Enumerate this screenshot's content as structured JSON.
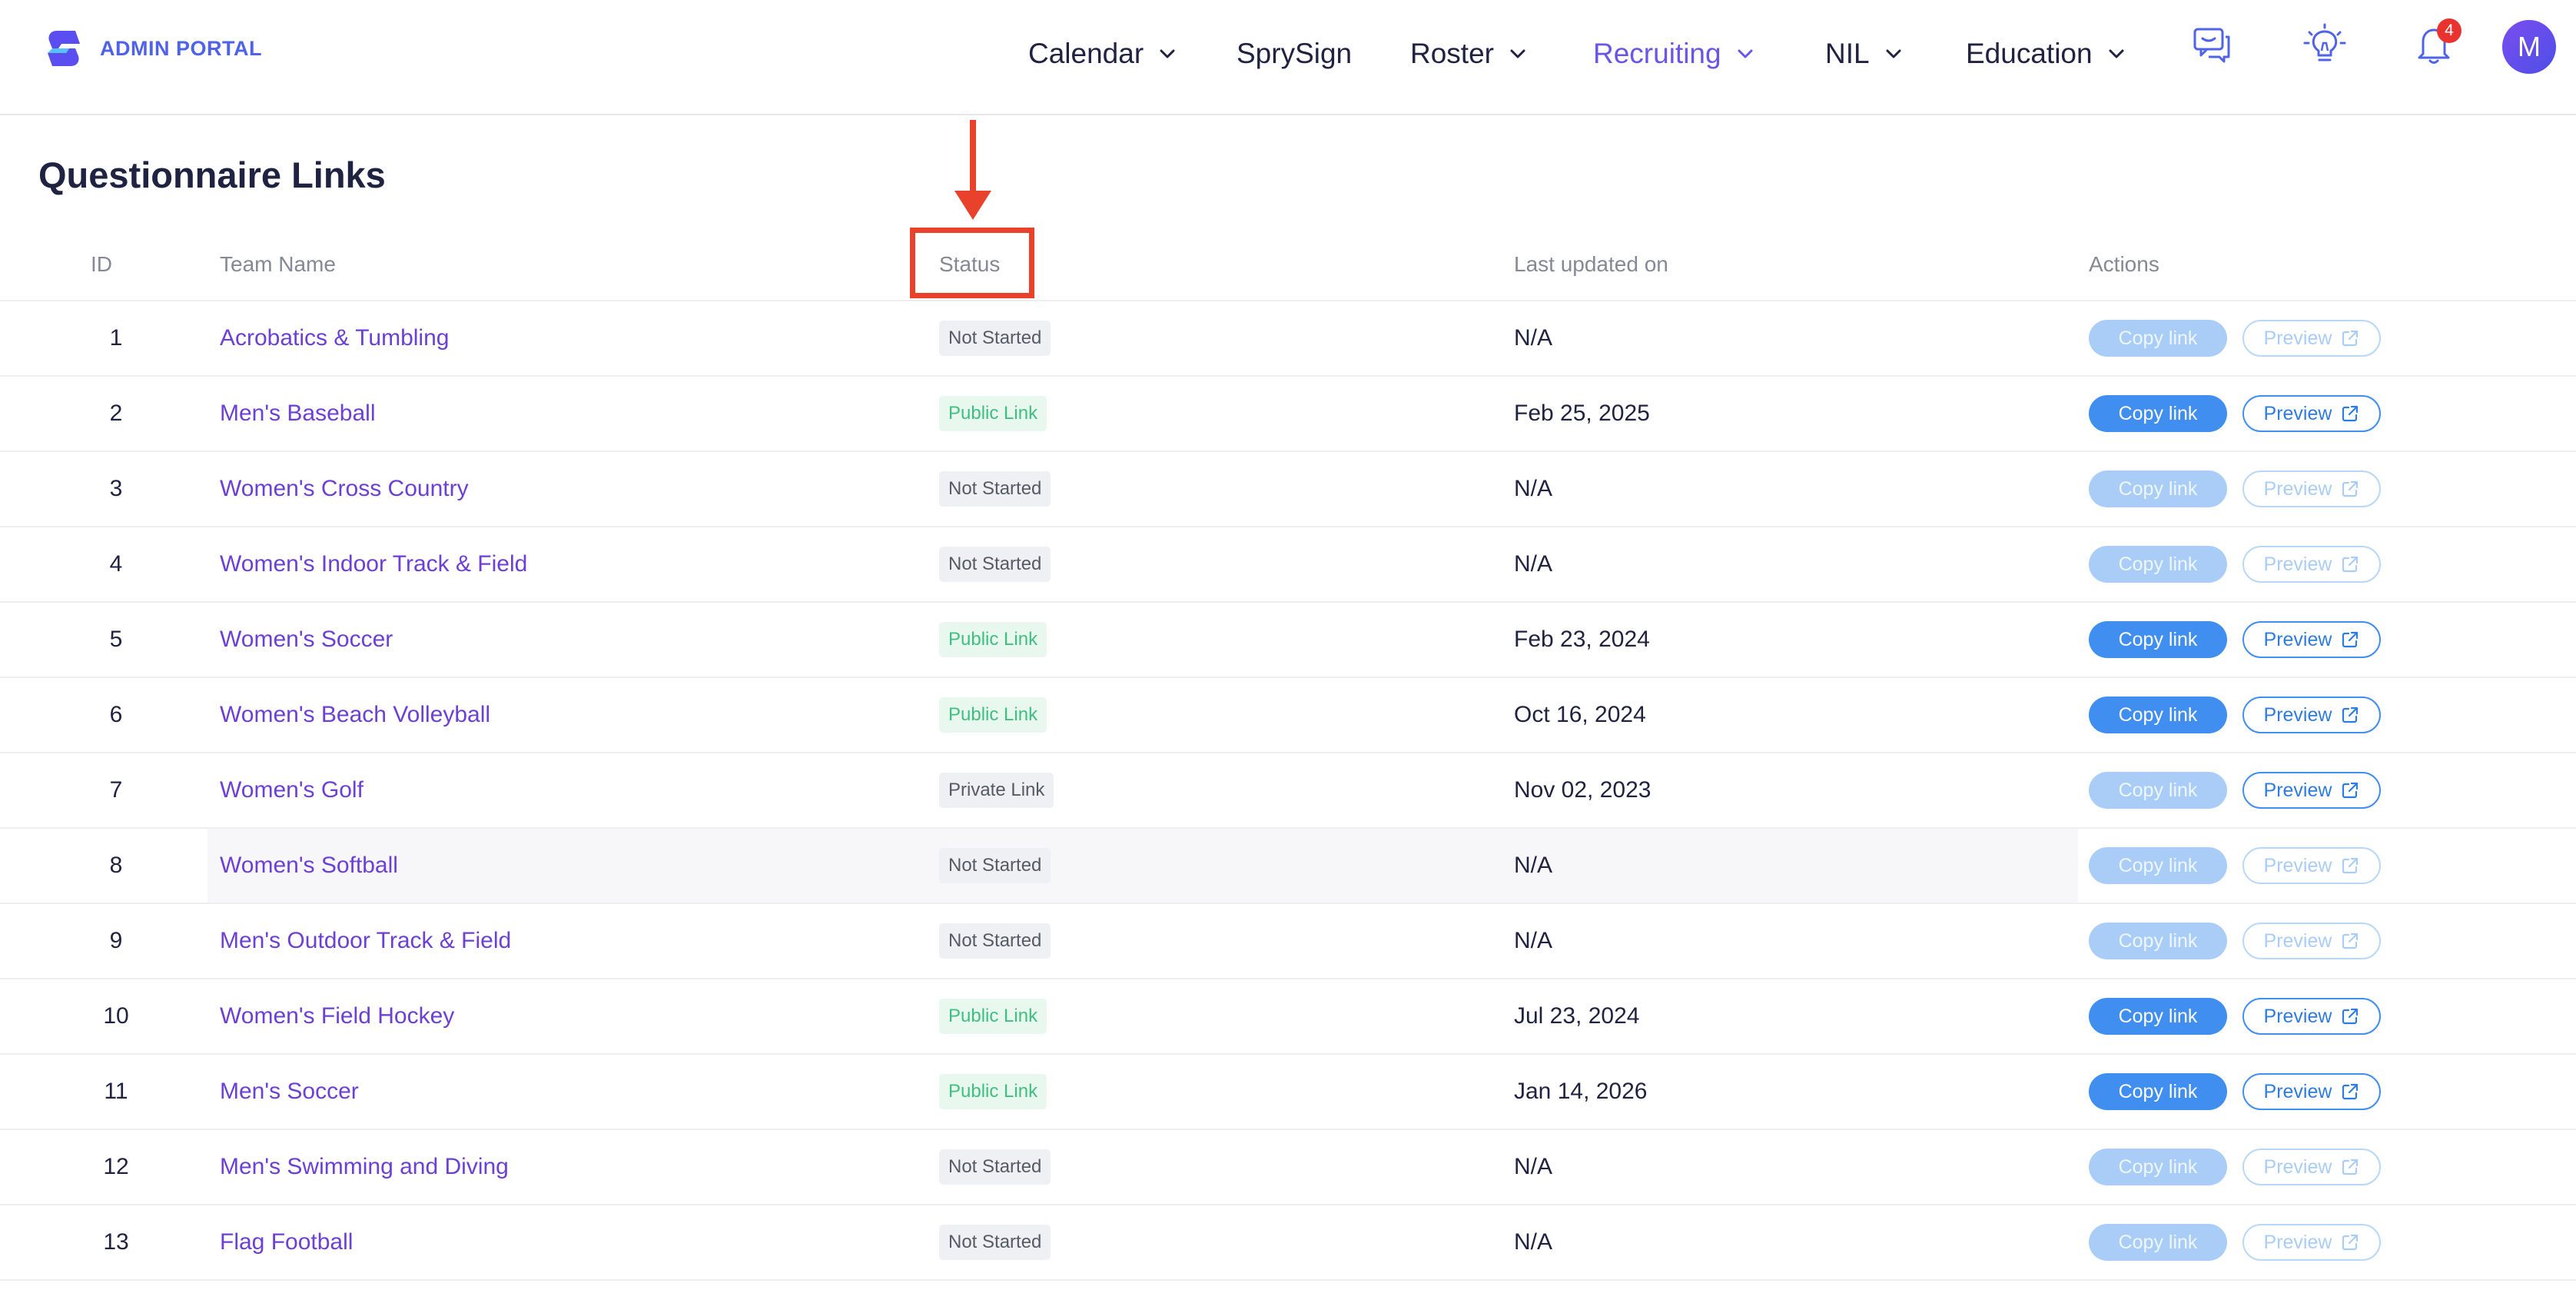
{
  "brand": {
    "name": "ADMIN PORTAL"
  },
  "nav": {
    "calendar": "Calendar",
    "sprysign": "SprySign",
    "roster": "Roster",
    "recruiting": "Recruiting",
    "nil": "NIL",
    "education": "Education"
  },
  "notifications": {
    "count": "4"
  },
  "user": {
    "avatar_initial": "M"
  },
  "page": {
    "title": "Questionnaire Links"
  },
  "table": {
    "headers": {
      "id": "ID",
      "team_name": "Team Name",
      "status": "Status",
      "last_updated": "Last updated on",
      "actions": "Actions"
    },
    "action_labels": {
      "copy": "Copy link",
      "preview": "Preview"
    },
    "rows": [
      {
        "id": "1",
        "team": "Acrobatics & Tumbling",
        "status": "Not Started",
        "updated": "N/A"
      },
      {
        "id": "2",
        "team": "Men's Baseball",
        "status": "Public Link",
        "updated": "Feb 25, 2025"
      },
      {
        "id": "3",
        "team": "Women's Cross Country",
        "status": "Not Started",
        "updated": "N/A"
      },
      {
        "id": "4",
        "team": "Women's Indoor Track & Field",
        "status": "Not Started",
        "updated": "N/A"
      },
      {
        "id": "5",
        "team": "Women's Soccer",
        "status": "Public Link",
        "updated": "Feb 23, 2024"
      },
      {
        "id": "6",
        "team": "Women's Beach Volleyball",
        "status": "Public Link",
        "updated": "Oct 16, 2024"
      },
      {
        "id": "7",
        "team": "Women's Golf",
        "status": "Private Link",
        "updated": "Nov 02, 2023"
      },
      {
        "id": "8",
        "team": "Women's Softball",
        "status": "Not Started",
        "updated": "N/A"
      },
      {
        "id": "9",
        "team": "Men's Outdoor Track & Field",
        "status": "Not Started",
        "updated": "N/A"
      },
      {
        "id": "10",
        "team": "Women's Field Hockey",
        "status": "Public Link",
        "updated": "Jul 23, 2024"
      },
      {
        "id": "11",
        "team": "Men's Soccer",
        "status": "Public Link",
        "updated": "Jan 14, 2026"
      },
      {
        "id": "12",
        "team": "Men's Swimming and Diving",
        "status": "Not Started",
        "updated": "N/A"
      },
      {
        "id": "13",
        "team": "Flag Football",
        "status": "Not Started",
        "updated": "N/A"
      }
    ]
  },
  "colors": {
    "brand": "#4f63e8",
    "active_nav": "#6b55e8",
    "team_link": "#6c3fd6",
    "primary_button": "#3f8ef0",
    "annotation": "#e8412c",
    "public_badge_text": "#3fbf7f"
  },
  "icons": {
    "logo": "brand-s-logo-icon",
    "chat": "chat-feedback-icon",
    "idea": "lightbulb-icon",
    "notifications": "bell-icon",
    "dropdown": "chevron-down-icon",
    "external": "external-link-icon",
    "annotation": "down-arrow-icon"
  }
}
